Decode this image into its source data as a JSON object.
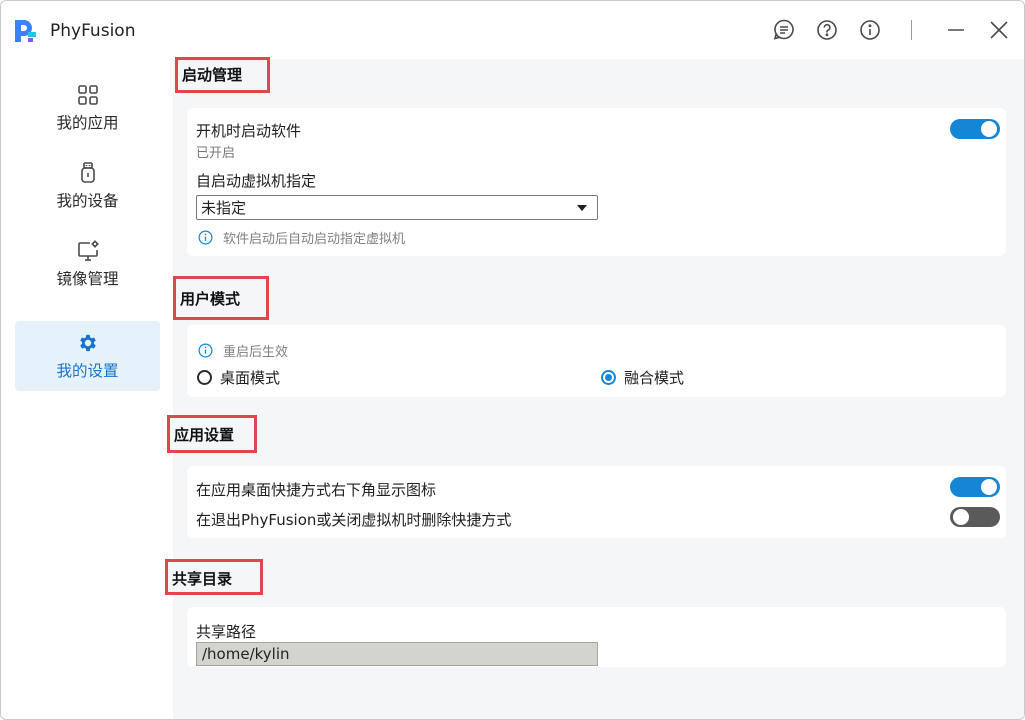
{
  "app": {
    "name": "PhyFusion"
  },
  "sidebar": {
    "items": [
      {
        "label": "我的应用",
        "icon": "apps-grid-icon"
      },
      {
        "label": "我的设备",
        "icon": "usb-device-icon"
      },
      {
        "label": "镜像管理",
        "icon": "monitor-settings-icon"
      },
      {
        "label": "我的设置",
        "icon": "gear-icon",
        "active": true
      }
    ]
  },
  "titlebar": {
    "buttons": [
      "feedback-icon",
      "help-icon",
      "info-icon",
      "minimize-icon",
      "close-icon"
    ]
  },
  "sections": {
    "startup": {
      "title": "启动管理",
      "autostart_label": "开机时启动软件",
      "autostart_status": "已开启",
      "autostart_on": true,
      "vm_label": "自启动虚拟机指定",
      "vm_value": "未指定",
      "vm_hint": "软件启动后自动启动指定虚拟机"
    },
    "user_mode": {
      "title": "用户模式",
      "hint": "重启后生效",
      "options": [
        {
          "label": "桌面模式",
          "checked": false
        },
        {
          "label": "融合模式",
          "checked": true
        }
      ]
    },
    "app_settings": {
      "title": "应用设置",
      "show_icon_label": "在应用桌面快捷方式右下角显示图标",
      "show_icon_on": true,
      "delete_shortcut_label": "在退出PhyFusion或关闭虚拟机时删除快捷方式",
      "delete_shortcut_on": false
    },
    "shared_dir": {
      "title": "共享目录",
      "path_label": "共享路径",
      "path_value": "/home/kylin"
    }
  },
  "colors": {
    "accent": "#1586d6",
    "highlight_border": "#e0474c",
    "active_nav_bg": "#e5f1fb"
  }
}
